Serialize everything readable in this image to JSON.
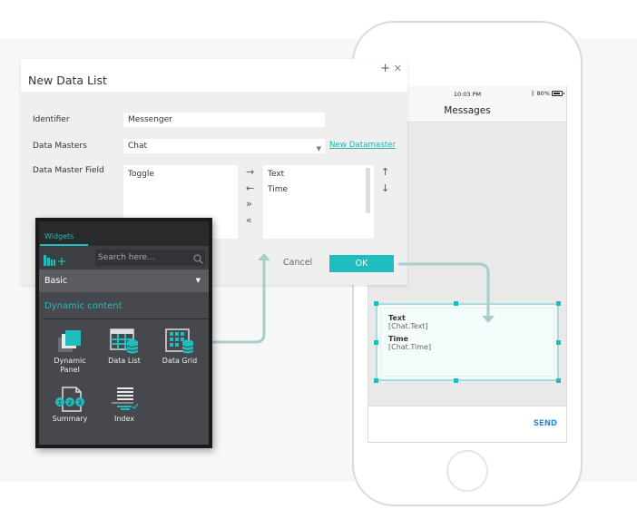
{
  "dialog": {
    "title": "New Data List",
    "plus_icon": "plus-icon",
    "close_icon": "close-icon",
    "identifier_label": "Identifier",
    "identifier_value": "Messenger",
    "data_masters_label": "Data Masters",
    "data_masters_value": "Chat",
    "new_datamaster_link": "New Datamaster",
    "field_label": "Data Master Field",
    "available_fields": [
      "Toggle"
    ],
    "selected_fields": [
      "Text",
      "Time"
    ],
    "transfer_buttons": {
      "add": "→",
      "remove": "←",
      "add_all": "»",
      "remove_all": "«"
    },
    "order_buttons": {
      "up": "↑",
      "down": "↓"
    },
    "cancel_label": "Cancel",
    "ok_label": "OK"
  },
  "widgets_panel": {
    "tab_label": "Widgets",
    "search_placeholder": "Search here...",
    "library_selected": "Basic",
    "section_title": "Dynamic content",
    "items": [
      {
        "label_line1": "Dynamic",
        "label_line2": "Panel",
        "icon": "dynamic-panel-icon"
      },
      {
        "label_line1": "Data List",
        "label_line2": "",
        "icon": "data-list-icon"
      },
      {
        "label_line1": "Data Grid",
        "label_line2": "",
        "icon": "data-grid-icon"
      },
      {
        "label_line1": "Summary",
        "label_line2": "",
        "icon": "summary-icon"
      },
      {
        "label_line1": "Index",
        "label_line2": "",
        "icon": "index-icon"
      }
    ]
  },
  "phone": {
    "status_time": "10:03 PM",
    "battery_text": "80%",
    "bluetooth_icon": "bluetooth-icon",
    "nav_title": "Messages",
    "data_list": {
      "field1_label": "Text",
      "field1_value": "[Chat.Text]",
      "field2_label": "Time",
      "field2_value": "[Chat.Time]"
    },
    "send_label": "SEND"
  },
  "colors": {
    "accent": "#1fbdbd",
    "widgets_bg": "#47484d",
    "connector": "#a8cdcd",
    "send": "#2b8ad9"
  }
}
